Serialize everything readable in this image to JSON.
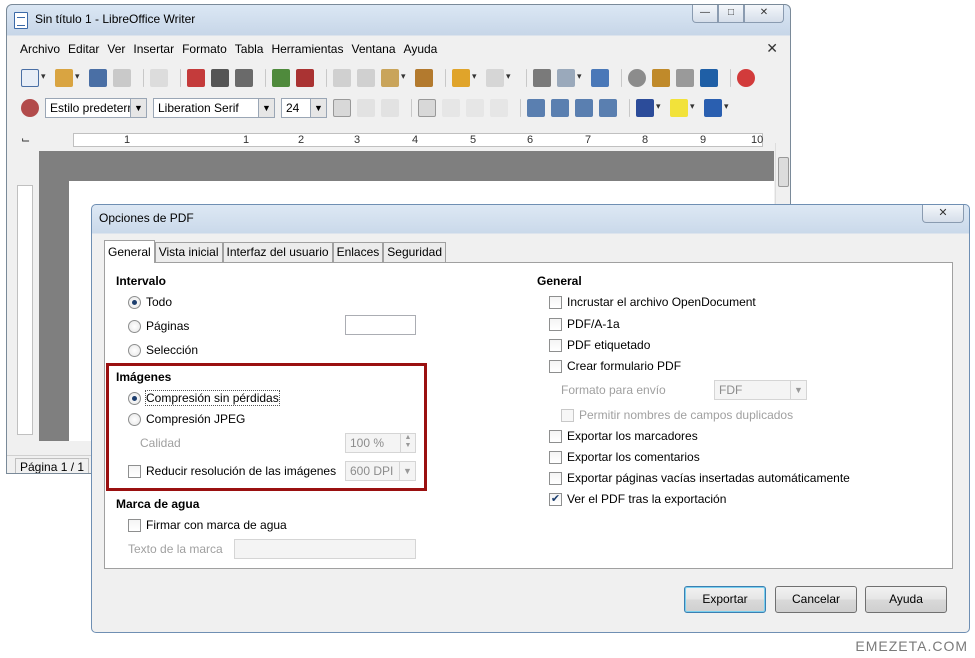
{
  "writer": {
    "title": "Sin título 1 - LibreOffice Writer",
    "menu": [
      "Archivo",
      "Editar",
      "Ver",
      "Insertar",
      "Formato",
      "Tabla",
      "Herramientas",
      "Ventana",
      "Ayuda"
    ],
    "paragraph_style": "Estilo predeterr",
    "font_name": "Liberation Serif",
    "font_size": "24",
    "ruler_numbers": [
      "1",
      "1",
      "2",
      "3",
      "4",
      "5",
      "6",
      "7",
      "8",
      "9",
      "10"
    ],
    "page_status": "Página 1 / 1"
  },
  "dialog": {
    "title": "Opciones de PDF",
    "tabs": [
      "General",
      "Vista inicial",
      "Interfaz del usuario",
      "Enlaces",
      "Seguridad"
    ],
    "active_tab": "General",
    "intervalo": {
      "heading": "Intervalo",
      "todo": "Todo",
      "paginas": "Páginas",
      "seleccion": "Selección",
      "selected": "Todo"
    },
    "imagenes": {
      "heading": "Imágenes",
      "lossless": "Compresión sin pérdidas",
      "jpeg": "Compresión JPEG",
      "quality_label": "Calidad",
      "quality_value": "100 %",
      "reduce_label": "Reducir resolución de las imágenes",
      "dpi_value": "600 DPI",
      "selected": "Compresión sin pérdidas"
    },
    "marca": {
      "heading": "Marca de agua",
      "sign": "Firmar con marca de agua",
      "text_label": "Texto de la marca"
    },
    "general": {
      "heading": "General",
      "embed_odf": "Incrustar el archivo OpenDocument",
      "pdfa": "PDF/A-1a",
      "tagged": "PDF etiquetado",
      "create_form": "Crear formulario PDF",
      "submit_format_label": "Formato para envío",
      "submit_format_value": "FDF",
      "allow_duplicates": "Permitir nombres de campos duplicados",
      "bookmarks": "Exportar los marcadores",
      "comments": "Exportar los comentarios",
      "blank_pages": "Exportar páginas vacías insertadas automáticamente",
      "view_pdf": "Ver el PDF tras la exportación",
      "view_pdf_checked": true
    },
    "buttons": {
      "export": "Exportar",
      "cancel": "Cancelar",
      "help": "Ayuda"
    }
  },
  "watermark_text": "EMEZETA.COM",
  "colors": {
    "highlight_box": "#9a1010",
    "dialog_border": "#6f8fb3"
  }
}
